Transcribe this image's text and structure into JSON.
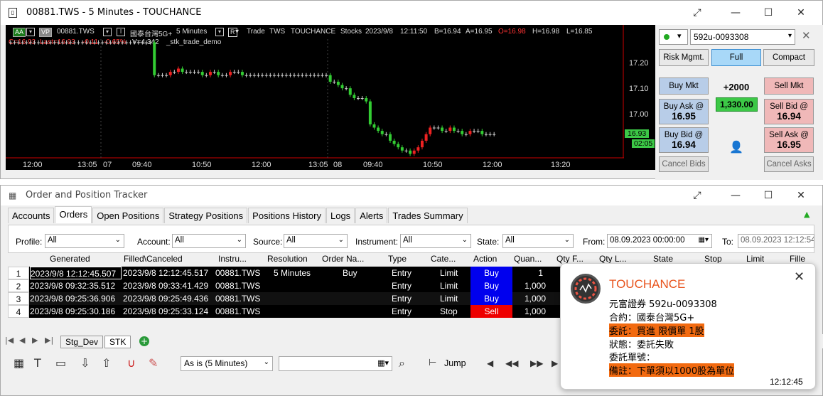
{
  "main_window": {
    "title": "00881.TWS - 5 Minutes - TOUCHANCE"
  },
  "chart_header": {
    "badge_aa": "AA",
    "badge_vp": "VP",
    "symbol": "00881.TWS",
    "name_cn": "國泰台灣5G+",
    "interval": "5 Minutes",
    "r_badge": "R",
    "trade": "Trade",
    "exchange": "TWS",
    "brand": "TOUCHANCE",
    "stocks": "Stocks",
    "date": "2023/9/8",
    "time": "12:11:50",
    "bid": "B=16.94",
    "ask": "A=16.95",
    "open": "O=16.98",
    "high": "H=16.98",
    "low": "L=16.85",
    "close_line": "C=16.93",
    "last_line": "Last=16.93",
    "change": "-0.11",
    "change_pct": "-0.65%",
    "volume": "V=4,342",
    "strategy": "_stk_trade_demo"
  },
  "chart_axes": {
    "y_labels": [
      "17.20",
      "17.10",
      "17.00"
    ],
    "x_labels": [
      "12:00",
      "13:05",
      "07",
      "09:40",
      "10:50",
      "12:00",
      "13:05",
      "08",
      "09:40",
      "10:50",
      "12:00",
      "13:20"
    ],
    "last_price_tag": "16.93",
    "time_tag": "02:05"
  },
  "chart_data": {
    "type": "candlestick",
    "series": [
      {
        "name": "",
        "values": [
          17.21,
          17.21,
          17.21,
          17.21,
          17.21,
          17.21,
          17.21,
          17.21,
          17.21,
          17.21,
          17.21,
          17.21,
          17.21,
          17.21,
          17.21,
          17.21,
          17.21,
          17.21,
          17.21,
          17.21,
          17.21,
          17.21,
          17.21,
          17.21,
          17.21,
          17.21,
          17.21,
          17.21,
          17.21,
          17.21,
          17.21,
          17.21,
          17.21,
          17.21,
          17.21,
          17.21,
          17.11,
          17.11,
          17.11,
          17.11,
          17.12,
          17.12,
          17.13,
          17.12,
          17.12,
          17.12,
          17.12,
          17.12,
          17.11,
          17.11,
          17.12,
          17.12,
          17.11,
          17.11,
          17.11,
          17.12,
          17.12,
          17.12,
          17.11,
          17.11,
          17.11,
          17.11,
          17.11,
          17.11,
          17.11,
          17.11,
          17.11,
          17.11,
          17.11,
          17.11,
          17.11,
          17.11,
          17.11,
          17.11,
          17.11,
          17.11,
          17.11,
          17.11,
          17.11,
          17.11,
          17.09,
          17.09,
          17.08,
          17.07,
          17.07,
          17.05,
          17.04,
          17.04,
          17.04,
          17.03,
          16.96,
          16.95,
          16.94,
          16.93,
          16.93,
          16.91,
          16.9,
          16.89,
          16.88,
          16.88,
          16.87,
          16.88,
          16.89,
          16.91,
          16.93,
          16.95,
          16.95,
          16.95,
          16.94,
          16.94,
          16.95,
          16.94,
          16.94,
          16.93,
          16.93,
          16.94,
          16.94,
          16.94,
          16.93,
          16.93,
          16.93,
          16.93
        ]
      }
    ],
    "ylim": [
      16.86,
      17.22
    ],
    "xlabel": "",
    "ylabel": ""
  },
  "side_panel": {
    "account": "592u-0093308",
    "risk_btn": "Risk Mgmt.",
    "full_btn": "Full",
    "compact_btn": "Compact",
    "buy_mkt": "Buy Mkt",
    "sell_mkt": "Sell Mkt",
    "buy_ask_label": "Buy Ask @",
    "buy_ask_price": "16.95",
    "sell_bid_label": "Sell Bid @",
    "sell_bid_price": "16.94",
    "buy_bid_label": "Buy Bid @",
    "buy_bid_price": "16.94",
    "sell_ask_label": "Sell Ask @",
    "sell_ask_price": "16.95",
    "qty": "+2000",
    "position_price": "1,330.00",
    "cancel_bids": "Cancel Bids",
    "cancel_asks": "Cancel Asks",
    "colors": {
      "buy": "#b8cde8",
      "sell": "#f0b8b8",
      "full": "#a8d8f8",
      "green": "#3cc846"
    }
  },
  "tracker": {
    "title": "Order and Position Tracker",
    "tabs": [
      "Accounts",
      "Orders",
      "Open Positions",
      "Strategy Positions",
      "Positions History",
      "Logs",
      "Alerts",
      "Trades Summary"
    ],
    "filters": {
      "profile_label": "Profile:",
      "profile": "All",
      "account_label": "Account:",
      "account": "All",
      "source_label": "Source:",
      "source": "All",
      "instrument_label": "Instrument:",
      "instrument": "All",
      "state_label": "State:",
      "state": "All",
      "from_label": "From:",
      "from": "08.09.2023 00:00:00",
      "to_label": "To:",
      "to": "08.09.2023 12:12:54"
    },
    "columns": [
      "Generated",
      "Filled\\Canceled",
      "Instru...",
      "Resolution",
      "Order Na...",
      "Type",
      "Cate...",
      "Action",
      "Quan...",
      "Qty F...",
      "Qty L...",
      "State",
      "Stop",
      "Limit",
      "Fille"
    ],
    "rows": [
      {
        "n": "1",
        "gen": "2023/9/8 12:12:45.507",
        "filled": "2023/9/8 12:12:45.517",
        "instr": "00881.TWS",
        "res": "5 Minutes",
        "name": "Buy",
        "type": "Entry",
        "cat": "Limit",
        "action": "Buy",
        "qty": "1"
      },
      {
        "n": "2",
        "gen": "2023/9/8 09:32:35.512",
        "filled": "2023/9/8 09:33:41.429",
        "instr": "00881.TWS",
        "res": "",
        "name": "",
        "type": "Entry",
        "cat": "Limit",
        "action": "Buy",
        "qty": "1,000"
      },
      {
        "n": "3",
        "gen": "2023/9/8 09:25:36.906",
        "filled": "2023/9/8 09:25:49.436",
        "instr": "00881.TWS",
        "res": "",
        "name": "",
        "type": "Entry",
        "cat": "Limit",
        "action": "Buy",
        "qty": "1,000"
      },
      {
        "n": "4",
        "gen": "2023/9/8 09:25:30.186",
        "filled": "2023/9/8 09:25:33.124",
        "instr": "00881.TWS",
        "res": "",
        "name": "",
        "type": "Entry",
        "cat": "Stop",
        "action": "Sell",
        "qty": "1,000"
      }
    ],
    "sheet_tabs": [
      "Stg_Dev",
      "STK"
    ],
    "toolbar": {
      "interval": "As is (5 Minutes)",
      "jump": "Jump"
    }
  },
  "toast": {
    "app": "TOUCHANCE",
    "line1": "元富證券 592u-0093308",
    "line2": "合約：國泰台灣5G+",
    "line3": "委託：買進 限價單 1股",
    "line4": "狀態：委託失敗",
    "line5": "委託單號：",
    "line6": "備註：下單須以1000股為單位",
    "time": "12:12:45"
  }
}
